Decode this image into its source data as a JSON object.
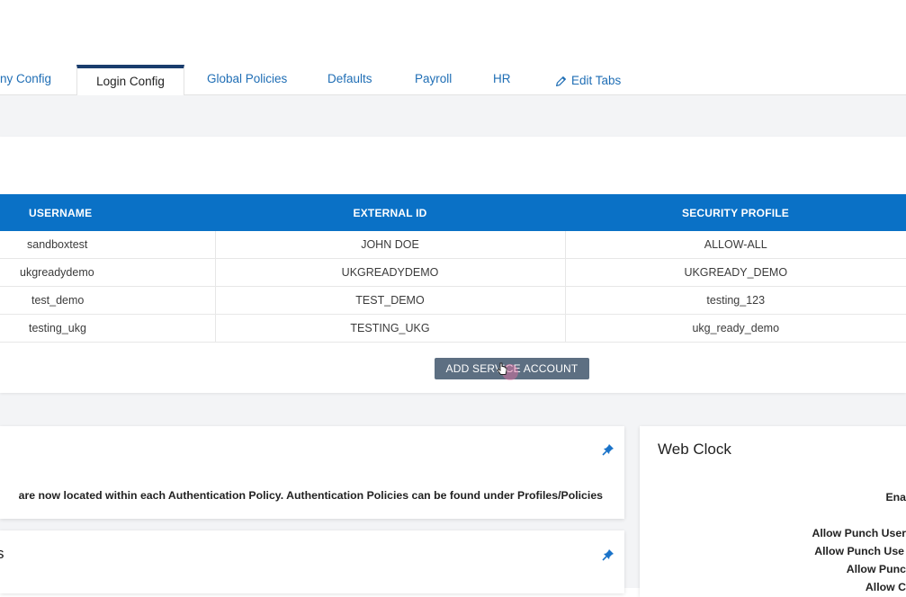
{
  "tabs": {
    "items": [
      {
        "label": "ny Config"
      },
      {
        "label": "Login Config"
      },
      {
        "label": "Global Policies"
      },
      {
        "label": "Defaults"
      },
      {
        "label": "Payroll"
      },
      {
        "label": "HR"
      }
    ],
    "edit_label": "Edit Tabs"
  },
  "service_accounts": {
    "columns": [
      "USERNAME",
      "EXTERNAL ID",
      "SECURITY PROFILE"
    ],
    "rows": [
      [
        "sandboxtest",
        "JOHN DOE",
        "ALLOW-ALL"
      ],
      [
        "ukgreadydemo",
        "UKGREADYDEMO",
        "UKGREADY_DEMO"
      ],
      [
        "test_demo",
        "TEST_DEMO",
        "testing_123"
      ],
      [
        "testing_ukg",
        "TESTING_UKG",
        "ukg_ready_demo"
      ]
    ],
    "add_button": "ADD SERVICE ACCOUNT"
  },
  "auth_panel": {
    "notice": "are now located within each Authentication Policy. Authentication Policies can be found under Profiles/Policies"
  },
  "second_panel": {
    "title_fragment": "s"
  },
  "web_clock": {
    "title": "Web Clock",
    "rows": [
      "Ena",
      "Allow Punch User",
      "Allow Punch Use",
      "Allow Punc",
      "Allow C"
    ]
  },
  "colors": {
    "accent": "#0a71c6",
    "active_tab_border": "#1a3d6d",
    "button": "#5d6f82",
    "link": "#1f6eb5"
  }
}
